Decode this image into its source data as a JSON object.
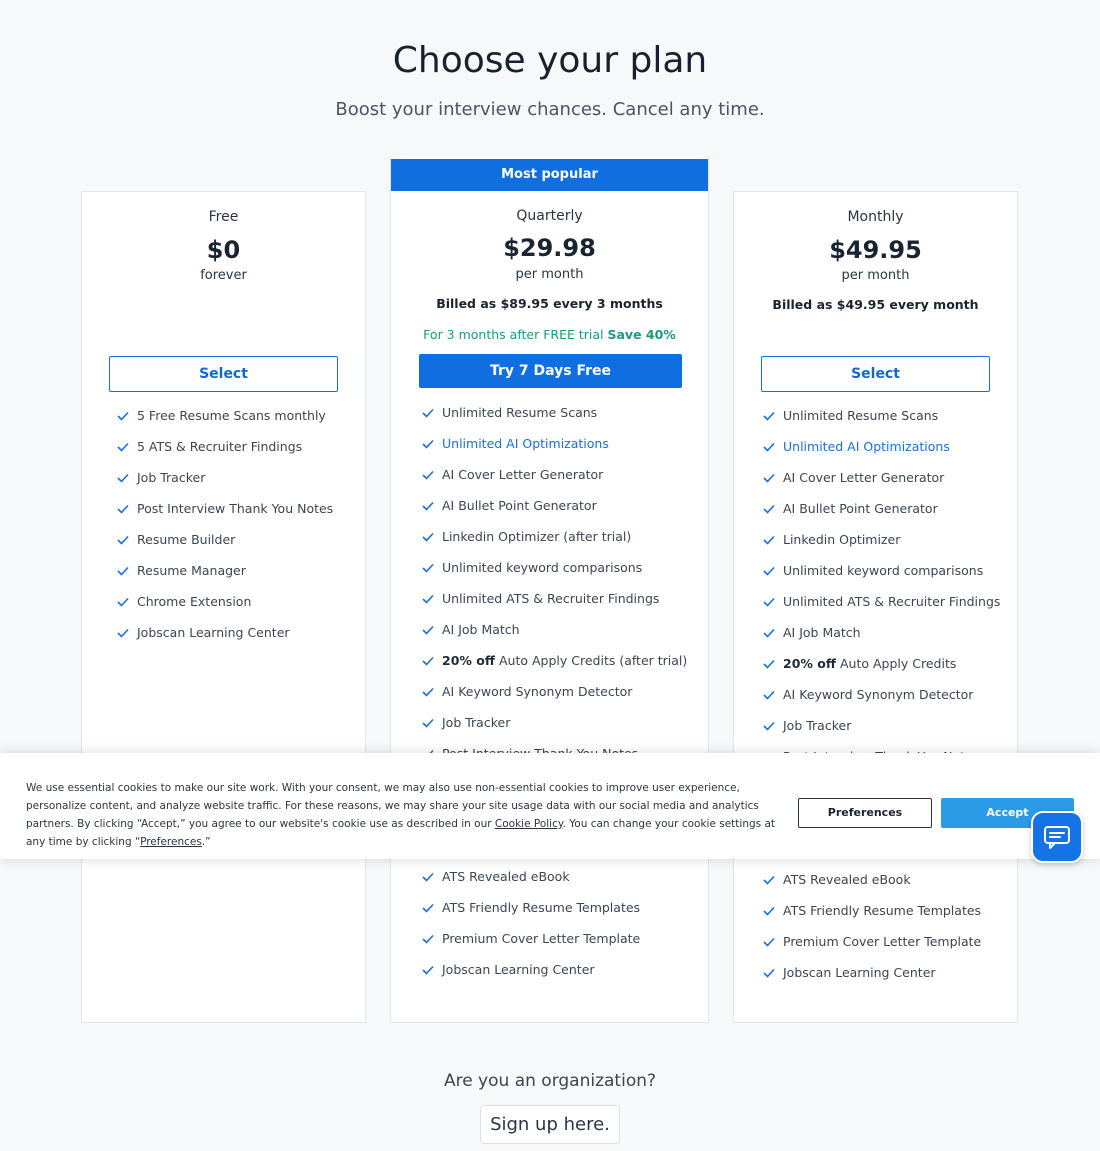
{
  "header": {
    "title": "Choose your plan",
    "subtitle": "Boost your interview chances. Cancel any time."
  },
  "plans": {
    "free": {
      "name": "Free",
      "price": "$0",
      "period": "forever",
      "button": "Select",
      "features": [
        {
          "text": "5 Free Resume Scans monthly"
        },
        {
          "text": "5 ATS & Recruiter Findings"
        },
        {
          "text": "Job Tracker"
        },
        {
          "text": "Post Interview Thank You Notes"
        },
        {
          "text": "Resume Builder"
        },
        {
          "text": "Resume Manager"
        },
        {
          "text": "Chrome Extension"
        },
        {
          "text": "Jobscan Learning Center"
        }
      ]
    },
    "quarterly": {
      "badge": "Most popular",
      "name": "Quarterly",
      "price": "$29.98",
      "period": "per month",
      "billed": "Billed as $89.95 every 3 months",
      "trial_text": "For 3 months after FREE trial",
      "trial_save": "Save 40%",
      "button": "Try 7 Days Free",
      "features_top": [
        {
          "text": "Unlimited Resume Scans"
        },
        {
          "text": "Unlimited AI Optimizations",
          "highlight": true
        },
        {
          "text": "AI Cover Letter Generator"
        },
        {
          "text": "AI Bullet Point Generator"
        },
        {
          "text": "Linkedin Optimizer (after trial)"
        },
        {
          "text": "Unlimited keyword comparisons"
        },
        {
          "text": "Unlimited ATS & Recruiter Findings"
        },
        {
          "text": "AI Job Match"
        },
        {
          "bold": "20% off",
          "text": "Auto Apply Credits (after trial)"
        },
        {
          "text": "AI Keyword Synonym Detector"
        },
        {
          "text": "Job Tracker"
        },
        {
          "text": "Post Interview Thank You Notes"
        }
      ],
      "features_bottom": [
        {
          "text": "ATS Revealed eBook"
        },
        {
          "text": "ATS Friendly Resume Templates"
        },
        {
          "text": "Premium Cover Letter Template"
        },
        {
          "text": "Jobscan Learning Center"
        }
      ]
    },
    "monthly": {
      "name": "Monthly",
      "price": "$49.95",
      "period": "per month",
      "billed": "Billed as $49.95 every month",
      "button": "Select",
      "features_top": [
        {
          "text": "Unlimited Resume Scans"
        },
        {
          "text": "Unlimited AI Optimizations",
          "highlight": true
        },
        {
          "text": "AI Cover Letter Generator"
        },
        {
          "text": "AI Bullet Point Generator"
        },
        {
          "text": "Linkedin Optimizer"
        },
        {
          "text": "Unlimited keyword comparisons"
        },
        {
          "text": "Unlimited ATS & Recruiter Findings"
        },
        {
          "text": "AI Job Match"
        },
        {
          "bold": "20% off",
          "text": "Auto Apply Credits"
        },
        {
          "text": "AI Keyword Synonym Detector"
        },
        {
          "text": "Job Tracker"
        },
        {
          "text": "Post Interview Thank You Notes"
        }
      ],
      "features_bottom": [
        {
          "text": "ATS Revealed eBook"
        },
        {
          "text": "ATS Friendly Resume Templates"
        },
        {
          "text": "Premium Cover Letter Template"
        },
        {
          "text": "Jobscan Learning Center"
        }
      ]
    }
  },
  "cookie": {
    "text_1": "We use essential cookies to make our site work. With your consent, we may also use non-essential cookies to improve user experience, personalize content, and analyze website traffic. For these reasons, we may share your site usage data with our social media and analytics partners. By clicking “Accept,” you agree to our website's cookie use as described in our ",
    "policy_link": "Cookie Policy",
    "text_2": ". You can change your cookie settings at any time by clicking “",
    "preferences_link": "Preferences",
    "text_3": ".”",
    "preferences_button": "Preferences",
    "accept_button": "Accept"
  },
  "chat": {
    "icon": "chat-bubble-icon"
  },
  "organization": {
    "title": "Are you an organization?",
    "button": "Sign up here."
  },
  "colors": {
    "accent": "#0f6fe0",
    "trial_green": "#1a9a7a",
    "accept_blue": "#2b9be8"
  }
}
